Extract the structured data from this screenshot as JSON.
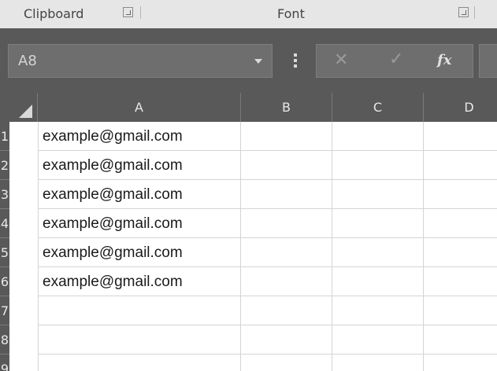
{
  "ribbon": {
    "groups": [
      {
        "name": "Clipboard"
      },
      {
        "name": "Font"
      }
    ]
  },
  "formula_bar": {
    "name_box_value": "A8",
    "cancel_glyph": "✕",
    "enter_glyph": "✓",
    "fx_label": "fx",
    "formula_value": ""
  },
  "grid": {
    "columns": [
      "A",
      "B",
      "C",
      "D"
    ],
    "rows": [
      {
        "num": "1",
        "A": "example@gmail.com"
      },
      {
        "num": "2",
        "A": "example@gmail.com"
      },
      {
        "num": "3",
        "A": "example@gmail.com"
      },
      {
        "num": "4",
        "A": "example@gmail.com"
      },
      {
        "num": "5",
        "A": "example@gmail.com"
      },
      {
        "num": "6",
        "A": "example@gmail.com"
      },
      {
        "num": "7",
        "A": ""
      },
      {
        "num": "8",
        "A": ""
      },
      {
        "num": "9",
        "A": ""
      }
    ]
  },
  "colors": {
    "header_bg": "#595959",
    "ribbon_bg": "#e6e6e6",
    "gridline": "#d4d4d4"
  }
}
